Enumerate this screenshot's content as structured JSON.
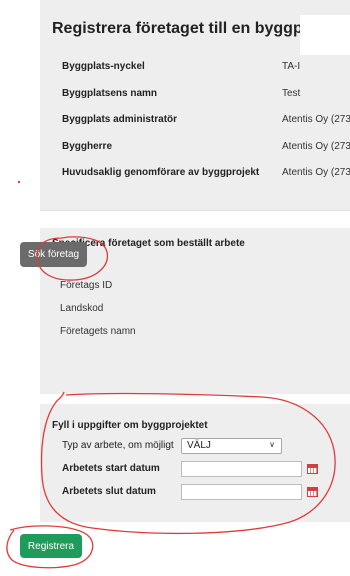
{
  "site_panel": {
    "title": "Registrera företaget till en byggplats:",
    "rows": [
      {
        "label": "Byggplats-nyckel",
        "value": "TA-I"
      },
      {
        "label": "Byggplatsens namn",
        "value": "Test"
      },
      {
        "label": "Byggplats administratör",
        "value": "Atentis Oy (273"
      },
      {
        "label": "Byggherre",
        "value": "Atentis Oy (273"
      },
      {
        "label": "Huvudsaklig genomförare av byggprojekt",
        "value": "Atentis Oy (273"
      }
    ]
  },
  "company_panel": {
    "heading": "Specificera företaget som beställt arbete",
    "search_button_label": "Sök företag",
    "fields": [
      "Företags ID",
      "Landskod",
      "Företagets namn"
    ]
  },
  "project_panel": {
    "heading": "Fyll i uppgifter om byggprojektet",
    "work_type_label": "Typ av arbete, om möjligt",
    "work_type_value": "VÄLJ",
    "start_date_label": "Arbetets start datum",
    "start_date_value": "",
    "end_date_label": "Arbetets slut datum",
    "end_date_value": ""
  },
  "register_button_label": "Registrera",
  "colors": {
    "panel_bg": "#eeeeee",
    "search_button": "#6b6b6b",
    "register_button": "#1f9c5a",
    "annotation": "#e03a3a",
    "calendar_icon": "#d14040"
  }
}
